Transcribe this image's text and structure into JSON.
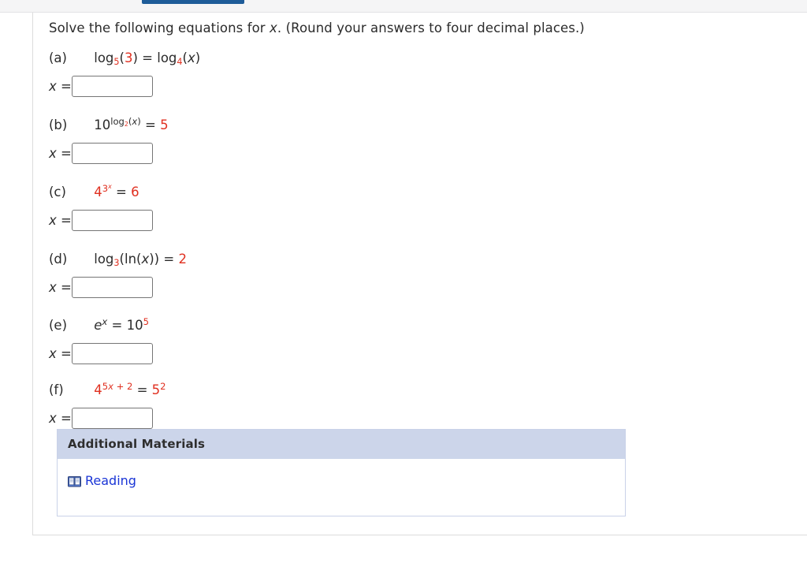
{
  "browser": {
    "active_tab_indicator": "active-tab"
  },
  "question": {
    "prompt_part1": "Solve the following equations for ",
    "prompt_var": "x",
    "prompt_part2": ". (Round your answers to four decimal places.)",
    "answer_label": "x =",
    "answer_value": "",
    "answer_placeholder": "",
    "parts": [
      {
        "label": "(a)",
        "equation_text": "log5(3) = log4(x)",
        "answer_label": "x =",
        "answer_value": ""
      },
      {
        "label": "(b)",
        "equation_text": "10^(log2(x)) = 5",
        "answer_label": "x =",
        "answer_value": ""
      },
      {
        "label": "(c)",
        "equation_text": "4^(3^x) = 6",
        "answer_label": "x =",
        "answer_value": ""
      },
      {
        "label": "(d)",
        "equation_text": "log3(ln(x)) = 2",
        "answer_label": "x =",
        "answer_value": ""
      },
      {
        "label": "(e)",
        "equation_text": "e^x = 10^5",
        "answer_label": "x =",
        "answer_value": ""
      },
      {
        "label": "(f)",
        "equation_text": "4^(5x + 2) = 5^2",
        "answer_label": "x =",
        "answer_value": ""
      }
    ]
  },
  "additional_materials": {
    "header": "Additional Materials",
    "items": [
      {
        "icon": "book-icon",
        "label": "Reading"
      }
    ]
  },
  "colors": {
    "equation_red": "#e03020",
    "equation_black": "#2b2b2b",
    "link_blue": "#1a35d6",
    "panel_header_bg": "#ccd5ea",
    "panel_border": "#c9d2e8",
    "tab_indicator": "#1e5c99"
  }
}
